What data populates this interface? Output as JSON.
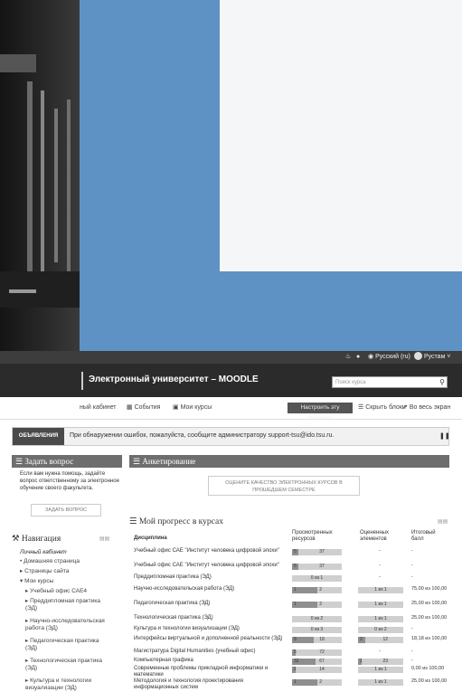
{
  "topbar": {
    "language": "Русский (ru)",
    "user": "Рустам"
  },
  "brand": {
    "title": "Электронный университет – MOODLE",
    "search_placeholder": "Поиск курса",
    "search_icon": "search-icon"
  },
  "navbar": {
    "dashboard": "ный кабинет",
    "events": "События",
    "my_courses": "Мои курсы",
    "configure": "Настроить эту страницу",
    "hide_blocks": "Скрыть блоки",
    "fullscreen": "Во весь экран"
  },
  "announcement": {
    "label": "ОБЪЯВЛЕНИЯ",
    "text": "При обнаружении ошибок, пожалуйста, сообщите администратору support-tsu@ido.tsu.ru."
  },
  "ask": {
    "title": "Задать вопрос",
    "text": "Если вам нужна помощь, задайте вопрос ответственному за электронное обучение своего факультета.",
    "button": "ЗАДАТЬ ВОПРОС"
  },
  "survey": {
    "title": "Анкетирование",
    "button": "ОЦЕНИТЕ КАЧЕСТВО ЭЛЕКТРОННЫХ КУРСОВ В ПРОШЕДШЕМ СЕМЕСТРЕ"
  },
  "progress": {
    "title": "Мой прогресс в курсах",
    "col_discipline": "Дисциплина",
    "col_viewed": "Просмотренных ресурсов",
    "col_graded": "Оцененных элементов",
    "col_grade": "Итоговый балл",
    "rows": [
      {
        "name": "Учебный офис САЕ \"Институт человека цифровой эпохи\"",
        "viewed": [
          5,
          37
        ],
        "graded": null,
        "grade": "-"
      },
      {
        "name": "Учебный офис САЕ \"Институт человека цифровой эпохи\"",
        "viewed": [
          5,
          37
        ],
        "graded": null,
        "grade": "-"
      },
      {
        "name": "Преддипломная практика (ЭД)",
        "viewed_text": "0 из 1",
        "graded": null,
        "grade": "-"
      },
      {
        "name": "Научно-исследовательская работа (ЭД)",
        "viewed": [
          1,
          2
        ],
        "graded_text": "1 из 1",
        "grade": "75,00 из 100,00"
      },
      {
        "name": "Педагогическая практика (ЭД)",
        "viewed": [
          1,
          2
        ],
        "graded_text": "1 из 1",
        "grade": "25,00 из 100,00"
      },
      {
        "name": "Технологическая практика (ЭД)",
        "viewed_text": "0 из 2",
        "graded_text": "1 из 1",
        "grade": "25,00 из 100,00"
      },
      {
        "name": "Культура и технологии визуализации (ЭД)",
        "viewed_text": "0 из 3",
        "graded_text": "0 из 2",
        "grade": "-"
      },
      {
        "name": "Интерфейсы виртуальной и дополненной реальности (ЭД)",
        "viewed": [
          8,
          18
        ],
        "graded": [
          2,
          12
        ],
        "grade": "18,18 из 100,00"
      },
      {
        "name": "Магистратура Digital Humanities (учебный офис)",
        "viewed": [
          5,
          72
        ],
        "graded": null,
        "grade": "-"
      },
      {
        "name": "Компьютерная графика",
        "viewed": [
          32,
          67
        ],
        "graded": [
          1,
          23
        ],
        "grade": "-"
      },
      {
        "name": "Современные проблемы прикладной информатики и математики",
        "viewed": [
          1,
          14
        ],
        "graded_text": "1 из 1",
        "grade": "0,00 из 100,00"
      },
      {
        "name": "Методология и технология проектирования информационных систем",
        "viewed": [
          1,
          2
        ],
        "graded_text": "1 из 1",
        "grade": "25,00 из 100,00"
      }
    ]
  },
  "nav": {
    "title": "Навигация",
    "dashboard": "Личный кабинет",
    "home": "Домашняя страница",
    "site_pages": "Страницы сайта",
    "my_courses": "Мои курсы",
    "courses": [
      "Учебный офис САЕ4",
      "Преддипломная практика (ЭД)",
      "Научно-исследовательская работа (ЭД)",
      "Педагогическая практика (ЭД)",
      "Технологическая практика (ЭД)",
      "Культура и технологии визуализации (ЭД)"
    ]
  },
  "colors": {
    "accent": "#5f92c4",
    "header_dark": "#2b2b2b",
    "block_header": "#6e6e6e"
  }
}
